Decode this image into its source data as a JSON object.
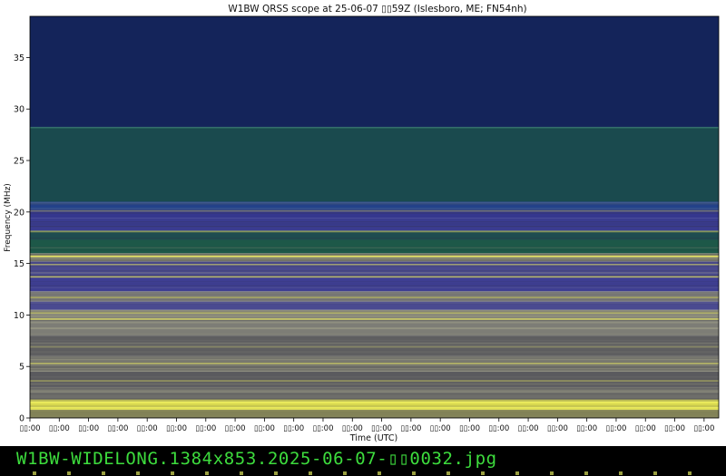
{
  "chart_data": {
    "type": "heatmap",
    "title": "W1BW QRSS scope at 25-06-07 ▯▯59Z (Islesboro, ME; FN54nh)",
    "xlabel": "Time (UTC)",
    "ylabel": "Frequency (MHz)",
    "ylim": [
      0,
      39
    ],
    "y_ticks": [
      0,
      5,
      10,
      15,
      20,
      25,
      30,
      35
    ],
    "x_tick_labels": [
      "▯▯:00",
      "▯▯:00",
      "▯▯:00",
      "▯▯:00",
      "▯▯:00",
      "▯▯:00",
      "▯▯:00",
      "▯▯:00",
      "▯▯:00",
      "▯▯:00",
      "▯▯:00",
      "▯▯:00",
      "▯▯:00",
      "▯▯:00",
      "▯▯:00",
      "▯▯:00",
      "▯▯:00",
      "▯▯:00",
      "▯▯:00",
      "▯▯:00",
      "▯▯:00",
      "▯▯:00",
      "▯▯:00",
      "▯▯:00"
    ],
    "grid": false,
    "bands": [
      {
        "y0": 0,
        "y1": 0.8,
        "color": "#8a8a5a"
      },
      {
        "y0": 0.8,
        "y1": 1.8,
        "color": "#d8d850"
      },
      {
        "y0": 1.8,
        "y1": 3.0,
        "color": "#6e6e6a"
      },
      {
        "y0": 3.0,
        "y1": 4.5,
        "color": "#5a5a5e"
      },
      {
        "y0": 4.5,
        "y1": 6.0,
        "color": "#7a7a70"
      },
      {
        "y0": 6.0,
        "y1": 8.0,
        "color": "#5e5e60"
      },
      {
        "y0": 8.0,
        "y1": 9.6,
        "color": "#7d7d76"
      },
      {
        "y0": 9.6,
        "y1": 10.5,
        "color": "#8a8a7a"
      },
      {
        "y0": 10.5,
        "y1": 11.3,
        "color": "#4a4a90"
      },
      {
        "y0": 11.3,
        "y1": 12.3,
        "color": "#7a7a78"
      },
      {
        "y0": 12.3,
        "y1": 13.6,
        "color": "#3e3e92"
      },
      {
        "y0": 13.6,
        "y1": 15.2,
        "color": "#4a4a8e"
      },
      {
        "y0": 15.2,
        "y1": 16.0,
        "color": "#7a7a6a"
      },
      {
        "y0": 16.0,
        "y1": 17.3,
        "color": "#1d5848"
      },
      {
        "y0": 17.3,
        "y1": 18.2,
        "color": "#1e4c50"
      },
      {
        "y0": 18.2,
        "y1": 19.4,
        "color": "#3a3c90"
      },
      {
        "y0": 19.4,
        "y1": 20.2,
        "color": "#35378e"
      },
      {
        "y0": 20.2,
        "y1": 21.0,
        "color": "#23428a"
      },
      {
        "y0": 21.0,
        "y1": 28.2,
        "color": "#1a4a4e"
      },
      {
        "y0": 28.2,
        "y1": 39,
        "color": "#14245a"
      }
    ],
    "signal_lines": [
      {
        "freq": 1.0,
        "color": "#f0f060",
        "opacity": 0.8
      },
      {
        "freq": 1.5,
        "color": "#f0f060",
        "opacity": 0.9
      },
      {
        "freq": 3.6,
        "color": "#d0d060",
        "opacity": 0.5
      },
      {
        "freq": 5.3,
        "color": "#dcdc60",
        "opacity": 0.6
      },
      {
        "freq": 6.9,
        "color": "#b8b870",
        "opacity": 0.5
      },
      {
        "freq": 9.6,
        "color": "#e4e460",
        "opacity": 0.7
      },
      {
        "freq": 10.2,
        "color": "#d8d860",
        "opacity": 0.5
      },
      {
        "freq": 11.7,
        "color": "#d0d060",
        "opacity": 0.6
      },
      {
        "freq": 13.7,
        "color": "#e8e860",
        "opacity": 0.7
      },
      {
        "freq": 14.9,
        "color": "#d8d860",
        "opacity": 0.6
      },
      {
        "freq": 15.7,
        "color": "#f0f060",
        "opacity": 0.9
      },
      {
        "freq": 18.1,
        "color": "#c8c860",
        "opacity": 0.6
      },
      {
        "freq": 20.1,
        "color": "#c8c860",
        "opacity": 0.4
      },
      {
        "freq": 28.2,
        "color": "#3c8c70",
        "opacity": 0.6
      }
    ]
  },
  "caption": {
    "text": "W1BW-WIDELONG.1384x853.2025-06-07-▯▯0032.jpg",
    "color": "#3ddc3d"
  }
}
